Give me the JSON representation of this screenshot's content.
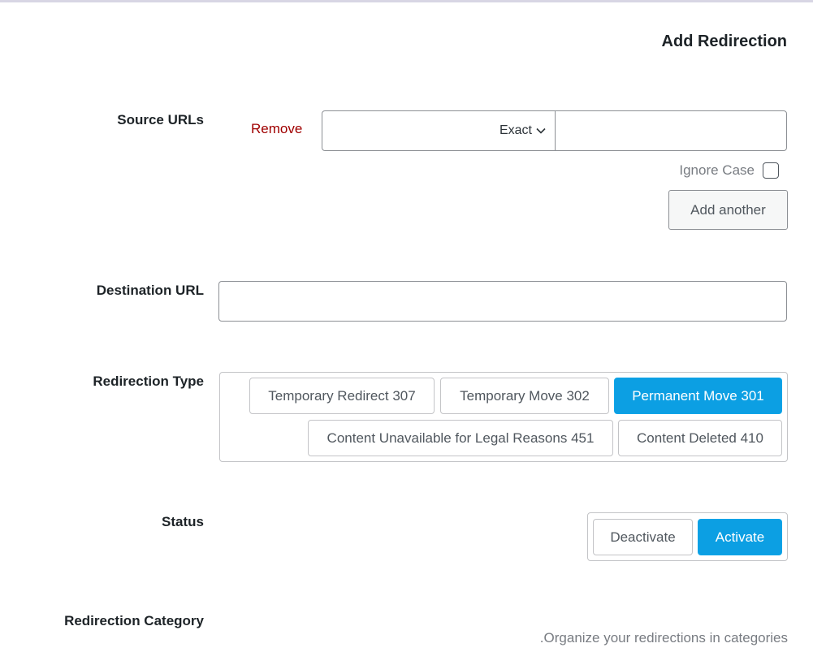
{
  "form": {
    "title": "Add Redirection",
    "source": {
      "label": "Source URLs",
      "remove_label": "Remove",
      "match_type": "Exact",
      "url_value": "",
      "ignore_case_label": "Ignore Case",
      "ignore_case_checked": false,
      "add_another_label": "Add another"
    },
    "destination": {
      "label": "Destination URL",
      "value": ""
    },
    "redirection_type": {
      "label": "Redirection Type",
      "options": [
        {
          "label": "Temporary Redirect 307",
          "selected": false
        },
        {
          "label": "Temporary Move 302",
          "selected": false
        },
        {
          "label": "Permanent Move 301",
          "selected": true
        },
        {
          "label": "Content Unavailable for Legal Reasons 451",
          "selected": false
        },
        {
          "label": "Content Deleted 410",
          "selected": false
        }
      ]
    },
    "status": {
      "label": "Status",
      "options": [
        {
          "label": "Deactivate",
          "selected": false
        },
        {
          "label": "Activate",
          "selected": true
        }
      ]
    },
    "category": {
      "label": "Redirection Category",
      "hint": ".Organize your redirections in categories"
    }
  },
  "colors": {
    "accent": "#0c9fe3",
    "danger_link": "#a00000",
    "muted_text": "#787c82"
  }
}
